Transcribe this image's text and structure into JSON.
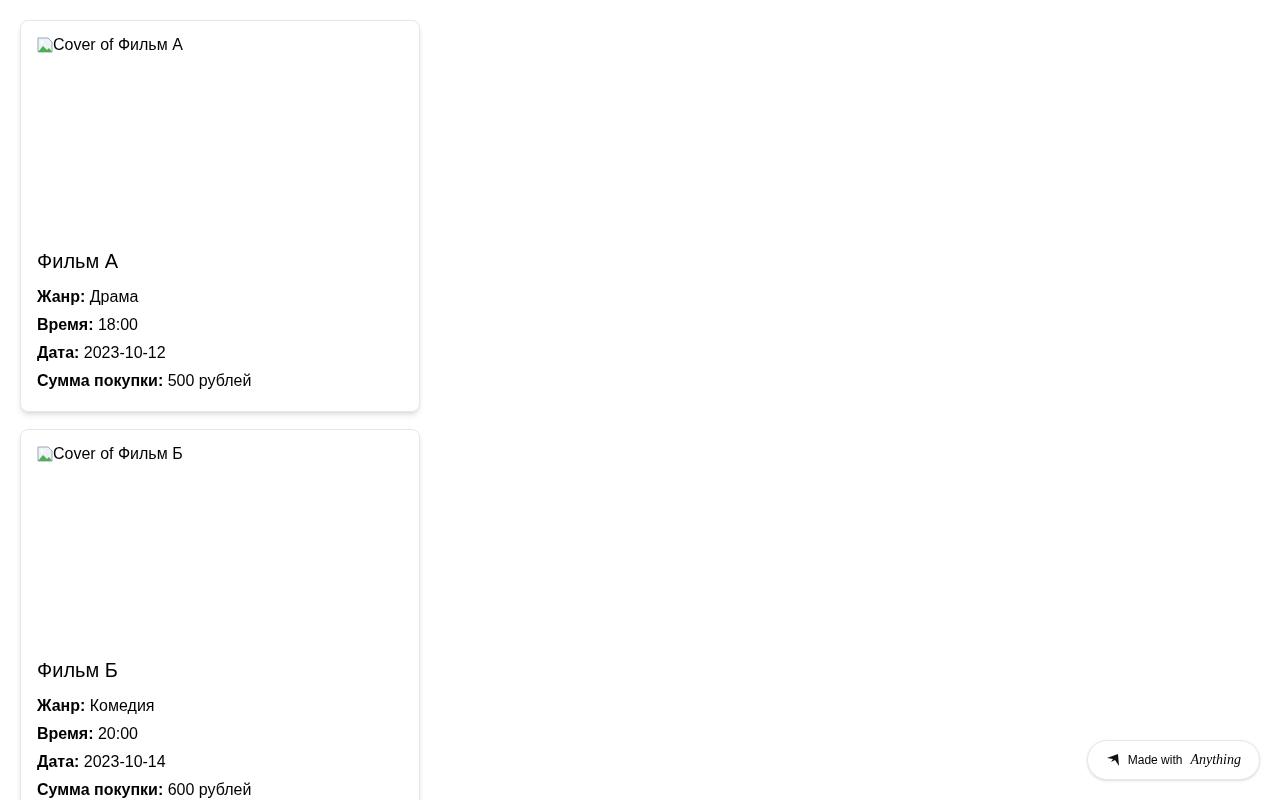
{
  "movies": [
    {
      "cover_alt": "Cover of Фильм А",
      "title": "Фильм А",
      "details": [
        "**Жанр:** Драма",
        "**Время:** 18:00",
        "**Дата:** 2023-10-12",
        "**Сумма покупки:** 500 рублей"
      ]
    },
    {
      "cover_alt": "Cover of Фильм Б",
      "title": "Фильм Б",
      "details": [
        "**Жанр:** Комедия",
        "**Время:** 20:00",
        "**Дата:** 2023-10-14",
        "**Сумма покупки:** 600 рублей"
      ]
    }
  ],
  "badge": {
    "prefix": "Made with",
    "brand": "Anything"
  }
}
